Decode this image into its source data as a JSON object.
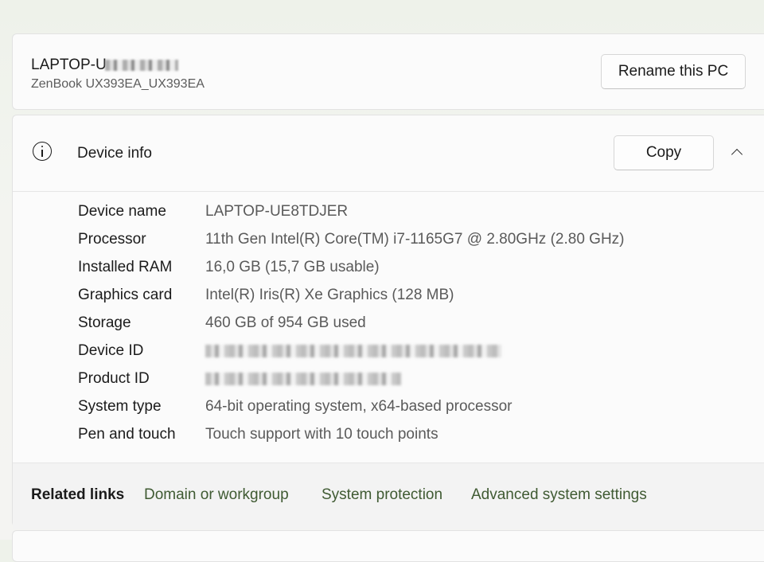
{
  "pc": {
    "name_prefix": "LAPTOP-U",
    "model": "ZenBook UX393EA_UX393EA",
    "rename_label": "Rename this PC"
  },
  "device_info": {
    "title": "Device info",
    "copy_label": "Copy",
    "specs": [
      {
        "label": "Device name",
        "value": "LAPTOP-UE8TDJER"
      },
      {
        "label": "Processor",
        "value": "11th Gen Intel(R) Core(TM) i7-1165G7 @ 2.80GHz (2.80 GHz)"
      },
      {
        "label": "Installed RAM",
        "value": "16,0 GB (15,7 GB usable)"
      },
      {
        "label": "Graphics card",
        "value": "Intel(R) Iris(R) Xe Graphics (128 MB)"
      },
      {
        "label": "Storage",
        "value": "460 GB of 954 GB used"
      },
      {
        "label": "Device ID",
        "value": ""
      },
      {
        "label": "Product ID",
        "value": ""
      },
      {
        "label": "System type",
        "value": "64-bit operating system, x64-based processor"
      },
      {
        "label": "Pen and touch",
        "value": "Touch support with 10 touch points"
      }
    ]
  },
  "related_links": {
    "title": "Related links",
    "links": [
      "Domain or workgroup",
      "System protection",
      "Advanced system settings"
    ]
  },
  "icons": {
    "info": "info-icon",
    "collapse": "chevron-up-icon"
  }
}
